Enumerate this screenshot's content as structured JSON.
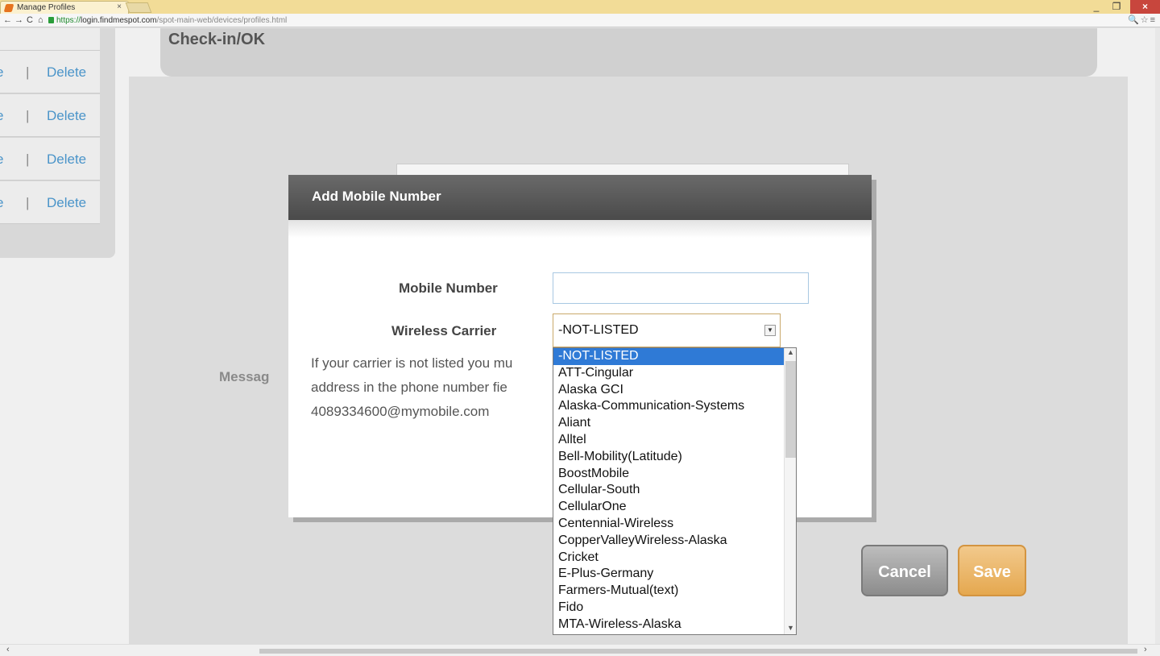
{
  "browser": {
    "tab_title": "Manage Profiles",
    "tab_close": "×",
    "url_protocol": "https://",
    "url_host": "login.findmespot.com",
    "url_path": "/spot-main-web/devices/profiles.html",
    "window_min": "_",
    "window_max": "❐",
    "window_close": "×",
    "nav_back": "←",
    "nav_forward": "→",
    "nav_reload": "C",
    "nav_home": "⌂",
    "addr_icons": "🔍☆≡"
  },
  "left_panel": {
    "rows": [
      {
        "trunc": "e",
        "pipe": "|",
        "label": "Delete"
      },
      {
        "trunc": "e",
        "pipe": "|",
        "label": "Delete"
      },
      {
        "trunc": "e",
        "pipe": "|",
        "label": "Delete"
      },
      {
        "trunc": "e",
        "pipe": "|",
        "label": "Delete"
      }
    ]
  },
  "section_title": "Check-in/OK",
  "message_label": "Messag",
  "buttons": {
    "cancel": "Cancel",
    "save": "Save"
  },
  "modal": {
    "title": "Add Mobile Number",
    "mobile_label": "Mobile Number",
    "mobile_value": "",
    "carrier_label": "Wireless Carrier",
    "carrier_selected": "-NOT-LISTED",
    "help_lines": [
      "If your carrier is not listed you mu",
      "address in the phone number fie",
      "4089334600@mymobile.com"
    ]
  },
  "carrier_options": [
    "-NOT-LISTED",
    "ATT-Cingular",
    "Alaska GCI",
    "Alaska-Communication-Systems",
    "Aliant",
    "Alltel",
    "Bell-Mobility(Latitude)",
    "BoostMobile",
    "Cellular-South",
    "CellularOne",
    "Centennial-Wireless",
    "CopperValleyWireless-Alaska",
    "Cricket",
    "E-Plus-Germany",
    "Farmers-Mutual(text)",
    "Fido",
    "MTA-Wireless-Alaska"
  ],
  "colors": {
    "link": "#4a94c9",
    "selected_option": "#2f7ad6",
    "save_button": "#e5a84f",
    "modal_header": "#4a4a4a"
  }
}
